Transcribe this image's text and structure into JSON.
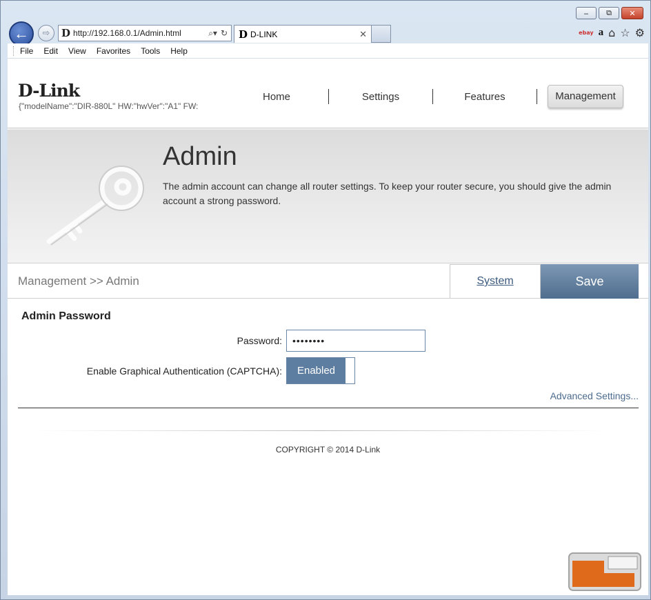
{
  "browser": {
    "url": "http://192.168.0.1/Admin.html",
    "tab_label": "D-LINK",
    "menu": [
      "File",
      "Edit",
      "View",
      "Favorites",
      "Tools",
      "Help"
    ]
  },
  "header": {
    "logo": "D-Link",
    "model_info": "{\"modelName\":\"DIR-880L\"   HW:\"hwVer\":\"A1\"   FW:",
    "nav": [
      "Home",
      "Settings",
      "Features",
      "Management"
    ],
    "active_nav": "Management"
  },
  "hero": {
    "title": "Admin",
    "description": "The admin account can change all router settings. To keep your router secure, you should give the admin account a strong password."
  },
  "toolbar": {
    "breadcrumb": "Management >> Admin",
    "system_label": "System",
    "save_label": "Save"
  },
  "form": {
    "section_title": "Admin Password",
    "password_label": "Password:",
    "password_value": "••••••••",
    "captcha_label": "Enable Graphical Authentication (CAPTCHA):",
    "captcha_state": "Enabled",
    "advanced_label": "Advanced Settings..."
  },
  "footer": {
    "copyright": "COPYRIGHT © 2014 D-Link"
  }
}
